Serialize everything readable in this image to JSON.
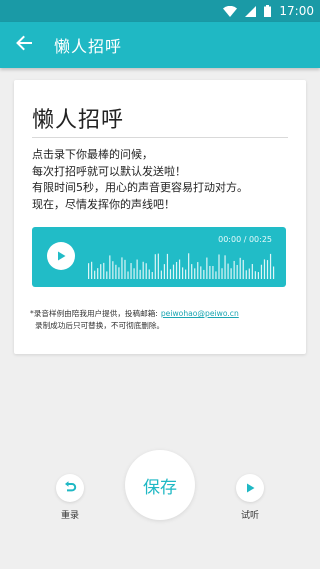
{
  "status_bar": {
    "time": "17:00",
    "icons": [
      "wifi-icon",
      "signal-icon",
      "battery-icon"
    ]
  },
  "app_bar": {
    "title": "懒人招呼",
    "back_icon": "arrow-left-icon"
  },
  "card": {
    "title": "懒人招呼",
    "description_lines": [
      "点击录下你最棒的问候，",
      "每次打招呼就可以默认发送啦！",
      "有限时间5秒，用心的声音更容易打动对方。",
      "现在，尽情发挥你的声线吧！"
    ],
    "player": {
      "time": "00:00 / 00:25",
      "play_icon": "play-icon"
    },
    "note": {
      "line1": "*录音样例由陪我用户提供，投稿邮箱:",
      "email": "peiwohao@peiwo.cn",
      "line2": "录制成功后只可替换，不可彻底删除。"
    }
  },
  "actions": {
    "rerecord_label": "重录",
    "rerecord_icon": "undo-icon",
    "save_label": "保存",
    "preview_label": "试听",
    "preview_icon": "play-icon"
  },
  "colors": {
    "primary": "#1fb8c4",
    "status_bar": "#1a9aa6",
    "player_bg": "#21bcc7",
    "background": "#efefef"
  }
}
